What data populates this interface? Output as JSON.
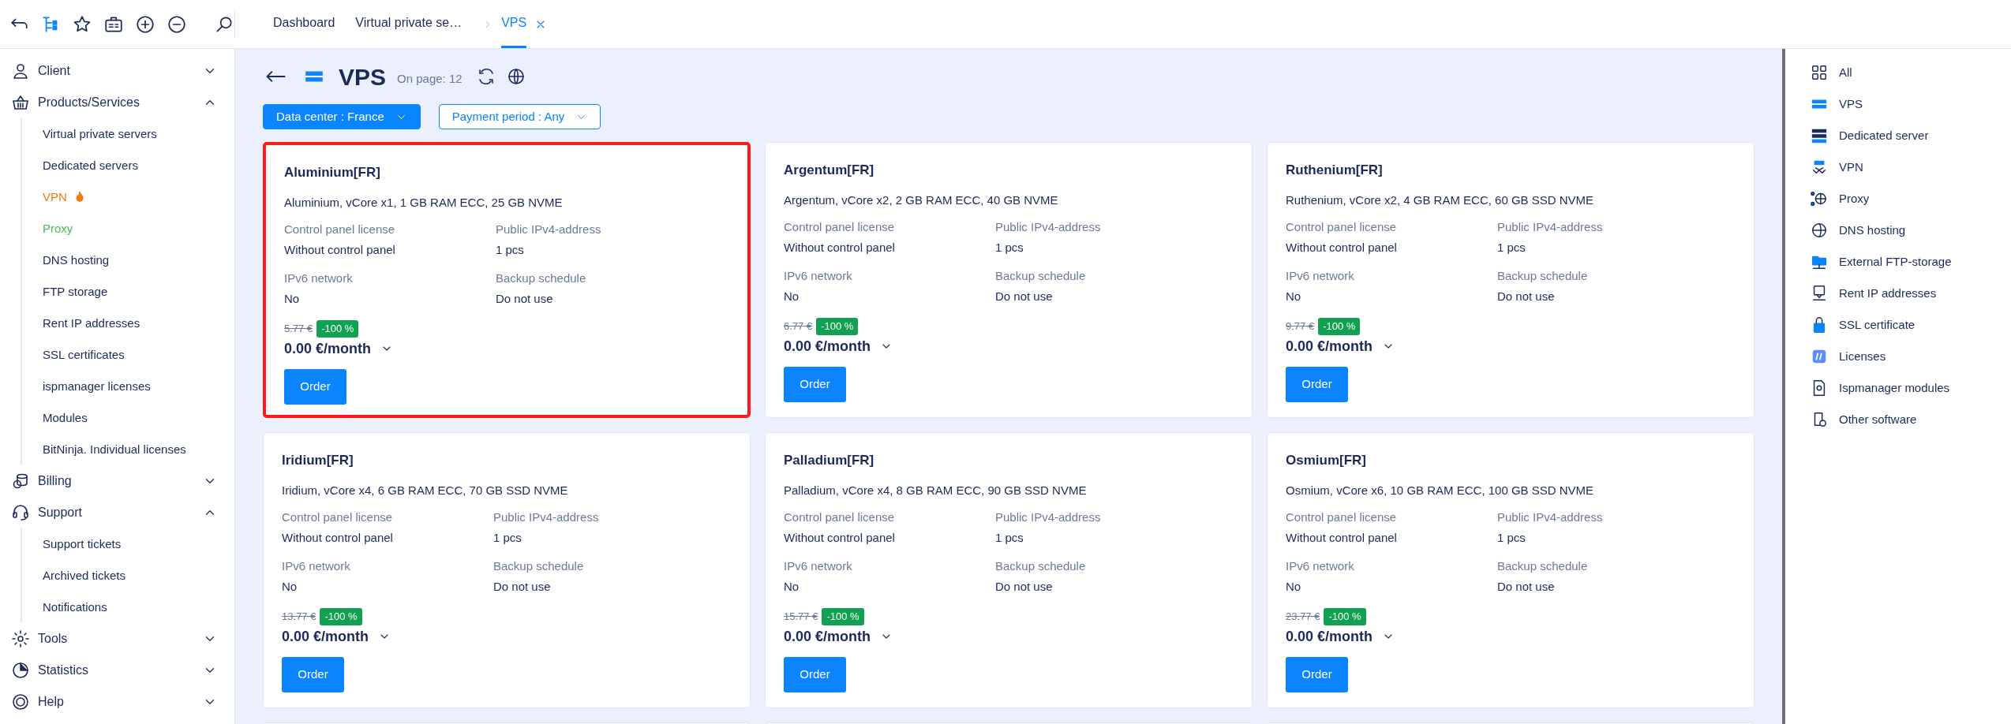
{
  "breadcrumbs": [
    {
      "label": "Dashboard",
      "selected": false,
      "closable": false
    },
    {
      "label": "Virtual private se…",
      "selected": false,
      "closable": false
    },
    {
      "label": "VPS",
      "selected": true,
      "closable": true
    }
  ],
  "sidebar": {
    "groups": [
      {
        "label": "Client",
        "expanded": false
      },
      {
        "label": "Products/Services",
        "expanded": true,
        "children": [
          {
            "label": "Virtual private servers",
            "color": "#1c2a5a",
            "hot": false
          },
          {
            "label": "Dedicated servers",
            "color": "#1c2a5a",
            "hot": false
          },
          {
            "label": "VPN",
            "color": "#f07a12",
            "hot": true
          },
          {
            "label": "Proxy",
            "color": "#4cbb52",
            "hot": false
          },
          {
            "label": "DNS hosting",
            "color": "#1c2a5a",
            "hot": false
          },
          {
            "label": "FTP storage",
            "color": "#1c2a5a",
            "hot": false
          },
          {
            "label": "Rent IP addresses",
            "color": "#1c2a5a",
            "hot": false
          },
          {
            "label": "SSL certificates",
            "color": "#1c2a5a",
            "hot": false
          },
          {
            "label": "ispmanager licenses",
            "color": "#1c2a5a",
            "hot": false
          },
          {
            "label": "Modules",
            "color": "#1c2a5a",
            "hot": false
          },
          {
            "label": "BitNinja. Individual licenses",
            "color": "#1c2a5a",
            "hot": false
          }
        ]
      },
      {
        "label": "Billing",
        "expanded": false
      },
      {
        "label": "Support",
        "expanded": true,
        "children": [
          {
            "label": "Support tickets",
            "color": "#1c2a5a",
            "hot": false
          },
          {
            "label": "Archived tickets",
            "color": "#1c2a5a",
            "hot": false
          },
          {
            "label": "Notifications",
            "color": "#1c2a5a",
            "hot": false
          }
        ]
      },
      {
        "label": "Tools",
        "expanded": false
      },
      {
        "label": "Statistics",
        "expanded": false
      },
      {
        "label": "Help",
        "expanded": false
      }
    ]
  },
  "page": {
    "title": "VPS",
    "on_page": "On page: 12",
    "filters": [
      {
        "label": "Data center : France",
        "primary": true
      },
      {
        "label": "Payment period : Any",
        "primary": false
      }
    ],
    "cards": [
      {
        "name": "Aluminium[FR]",
        "description": "Aluminium, vCore x1, 1 GB RAM ECC, 25 GB NVME",
        "highlighted": true,
        "specs": [
          {
            "label": "Control panel license",
            "value": "Without control panel"
          },
          {
            "label": "Public IPv4-address",
            "value": "1 pcs"
          },
          {
            "label": "IPv6 network",
            "value": "No"
          },
          {
            "label": "Backup schedule",
            "value": "Do not use"
          }
        ],
        "old_price": "5.77 €",
        "discount": "-100 %",
        "price": "0.00 €/month",
        "button": "Order"
      },
      {
        "name": "Argentum[FR]",
        "description": "Argentum, vCore x2, 2 GB RAM ECC, 40 GB NVME",
        "highlighted": false,
        "specs": [
          {
            "label": "Control panel license",
            "value": "Without control panel"
          },
          {
            "label": "Public IPv4-address",
            "value": "1 pcs"
          },
          {
            "label": "IPv6 network",
            "value": "No"
          },
          {
            "label": "Backup schedule",
            "value": "Do not use"
          }
        ],
        "old_price": "6.77 €",
        "discount": "-100 %",
        "price": "0.00 €/month",
        "button": "Order"
      },
      {
        "name": "Ruthenium[FR]",
        "description": "Ruthenium, vCore x2, 4 GB RAM ECC, 60 GB SSD NVME",
        "highlighted": false,
        "specs": [
          {
            "label": "Control panel license",
            "value": "Without control panel"
          },
          {
            "label": "Public IPv4-address",
            "value": "1 pcs"
          },
          {
            "label": "IPv6 network",
            "value": "No"
          },
          {
            "label": "Backup schedule",
            "value": "Do not use"
          }
        ],
        "old_price": "9.77 €",
        "discount": "-100 %",
        "price": "0.00 €/month",
        "button": "Order"
      },
      {
        "name": "Iridium[FR]",
        "description": "Iridium, vCore x4, 6 GB RAM ECC, 70 GB SSD NVME",
        "highlighted": false,
        "specs": [
          {
            "label": "Control panel license",
            "value": "Without control panel"
          },
          {
            "label": "Public IPv4-address",
            "value": "1 pcs"
          },
          {
            "label": "IPv6 network",
            "value": "No"
          },
          {
            "label": "Backup schedule",
            "value": "Do not use"
          }
        ],
        "old_price": "13.77 €",
        "discount": "-100 %",
        "price": "0.00 €/month",
        "button": "Order"
      },
      {
        "name": "Palladium[FR]",
        "description": "Palladium, vCore x4, 8 GB RAM ECC, 90 GB SSD NVME",
        "highlighted": false,
        "specs": [
          {
            "label": "Control panel license",
            "value": "Without control panel"
          },
          {
            "label": "Public IPv4-address",
            "value": "1 pcs"
          },
          {
            "label": "IPv6 network",
            "value": "No"
          },
          {
            "label": "Backup schedule",
            "value": "Do not use"
          }
        ],
        "old_price": "15.77 €",
        "discount": "-100 %",
        "price": "0.00 €/month",
        "button": "Order"
      },
      {
        "name": "Osmium[FR]",
        "description": "Osmium, vCore x6, 10 GB RAM ECC, 100 GB SSD NVME",
        "highlighted": false,
        "specs": [
          {
            "label": "Control panel license",
            "value": "Without control panel"
          },
          {
            "label": "Public IPv4-address",
            "value": "1 pcs"
          },
          {
            "label": "IPv6 network",
            "value": "No"
          },
          {
            "label": "Backup schedule",
            "value": "Do not use"
          }
        ],
        "old_price": "23.77 €",
        "discount": "-100 %",
        "price": "0.00 €/month",
        "button": "Order"
      }
    ]
  },
  "categories": [
    {
      "label": "All",
      "selected": false
    },
    {
      "label": "VPS",
      "selected": false
    },
    {
      "label": "Dedicated server",
      "selected": false
    },
    {
      "label": "VPN",
      "selected": false
    },
    {
      "label": "Proxy",
      "selected": false
    },
    {
      "label": "DNS hosting",
      "selected": false
    },
    {
      "label": "External FTP-storage",
      "selected": false
    },
    {
      "label": "Rent IP addresses",
      "selected": false
    },
    {
      "label": "SSL certificate",
      "selected": false
    },
    {
      "label": "Licenses",
      "selected": false
    },
    {
      "label": "Ispmanager modules",
      "selected": false
    },
    {
      "label": "Other software",
      "selected": false
    }
  ]
}
